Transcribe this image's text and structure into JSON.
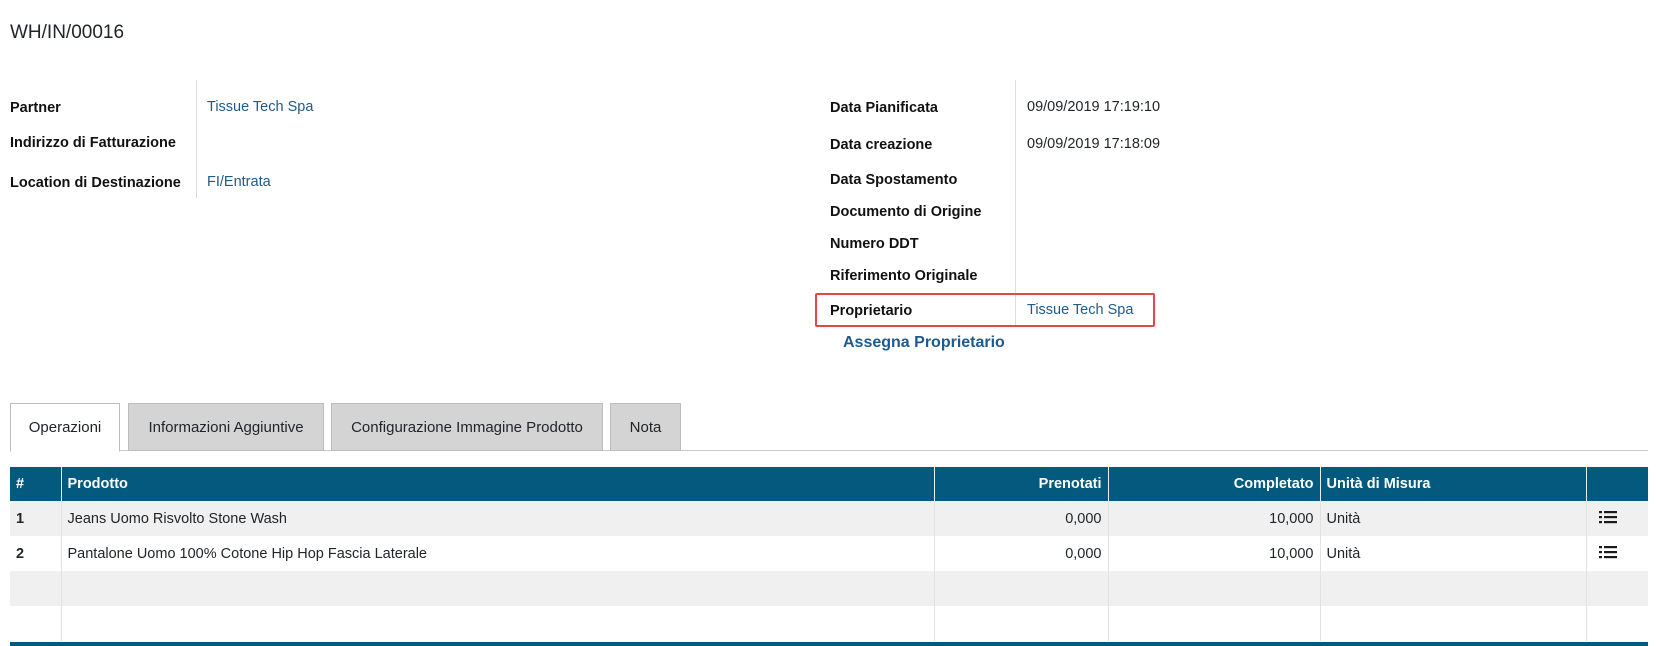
{
  "record": {
    "title": "WH/IN/00016"
  },
  "left_fields": [
    {
      "label": "Partner",
      "value": "Tissue Tech Spa"
    },
    {
      "label": "Indirizzo di Fatturazione",
      "value": ""
    },
    {
      "label": "Location di Destinazione",
      "value": "FI/Entrata"
    }
  ],
  "right_fields": [
    {
      "label": "Data Pianificata",
      "value": "09/09/2019 17:19:10"
    },
    {
      "label": "Data creazione",
      "value": "09/09/2019 17:18:09"
    },
    {
      "label": "Data Spostamento",
      "value": ""
    },
    {
      "label": "Documento di Origine",
      "value": ""
    },
    {
      "label": "Numero DDT",
      "value": ""
    },
    {
      "label": "Riferimento Originale",
      "value": ""
    },
    {
      "label": "Proprietario",
      "value": "Tissue Tech Spa"
    }
  ],
  "assign_owner_label": "Assegna Proprietario",
  "tabs": [
    {
      "label": "Operazioni",
      "active": true
    },
    {
      "label": "Informazioni Aggiuntive",
      "active": false
    },
    {
      "label": "Configurazione Immagine Prodotto",
      "active": false
    },
    {
      "label": "Nota",
      "active": false
    }
  ],
  "table": {
    "columns": [
      "#",
      "Prodotto",
      "Prenotati",
      "Completato",
      "Unità di Misura",
      ""
    ],
    "rows": [
      {
        "idx": "1",
        "product": "Jeans Uomo Risvolto Stone Wash",
        "reserved": "0,000",
        "done": "10,000",
        "uom": "Unità",
        "icon": "list-icon"
      },
      {
        "idx": "2",
        "product": "Pantalone Uomo 100% Cotone Hip Hop Fascia Laterale",
        "reserved": "0,000",
        "done": "10,000",
        "uom": "Unità",
        "icon": "list-icon"
      }
    ]
  },
  "colors": {
    "header_bg": "#035a7e",
    "link": "#1d5a8e",
    "highlight": "#e84545"
  }
}
